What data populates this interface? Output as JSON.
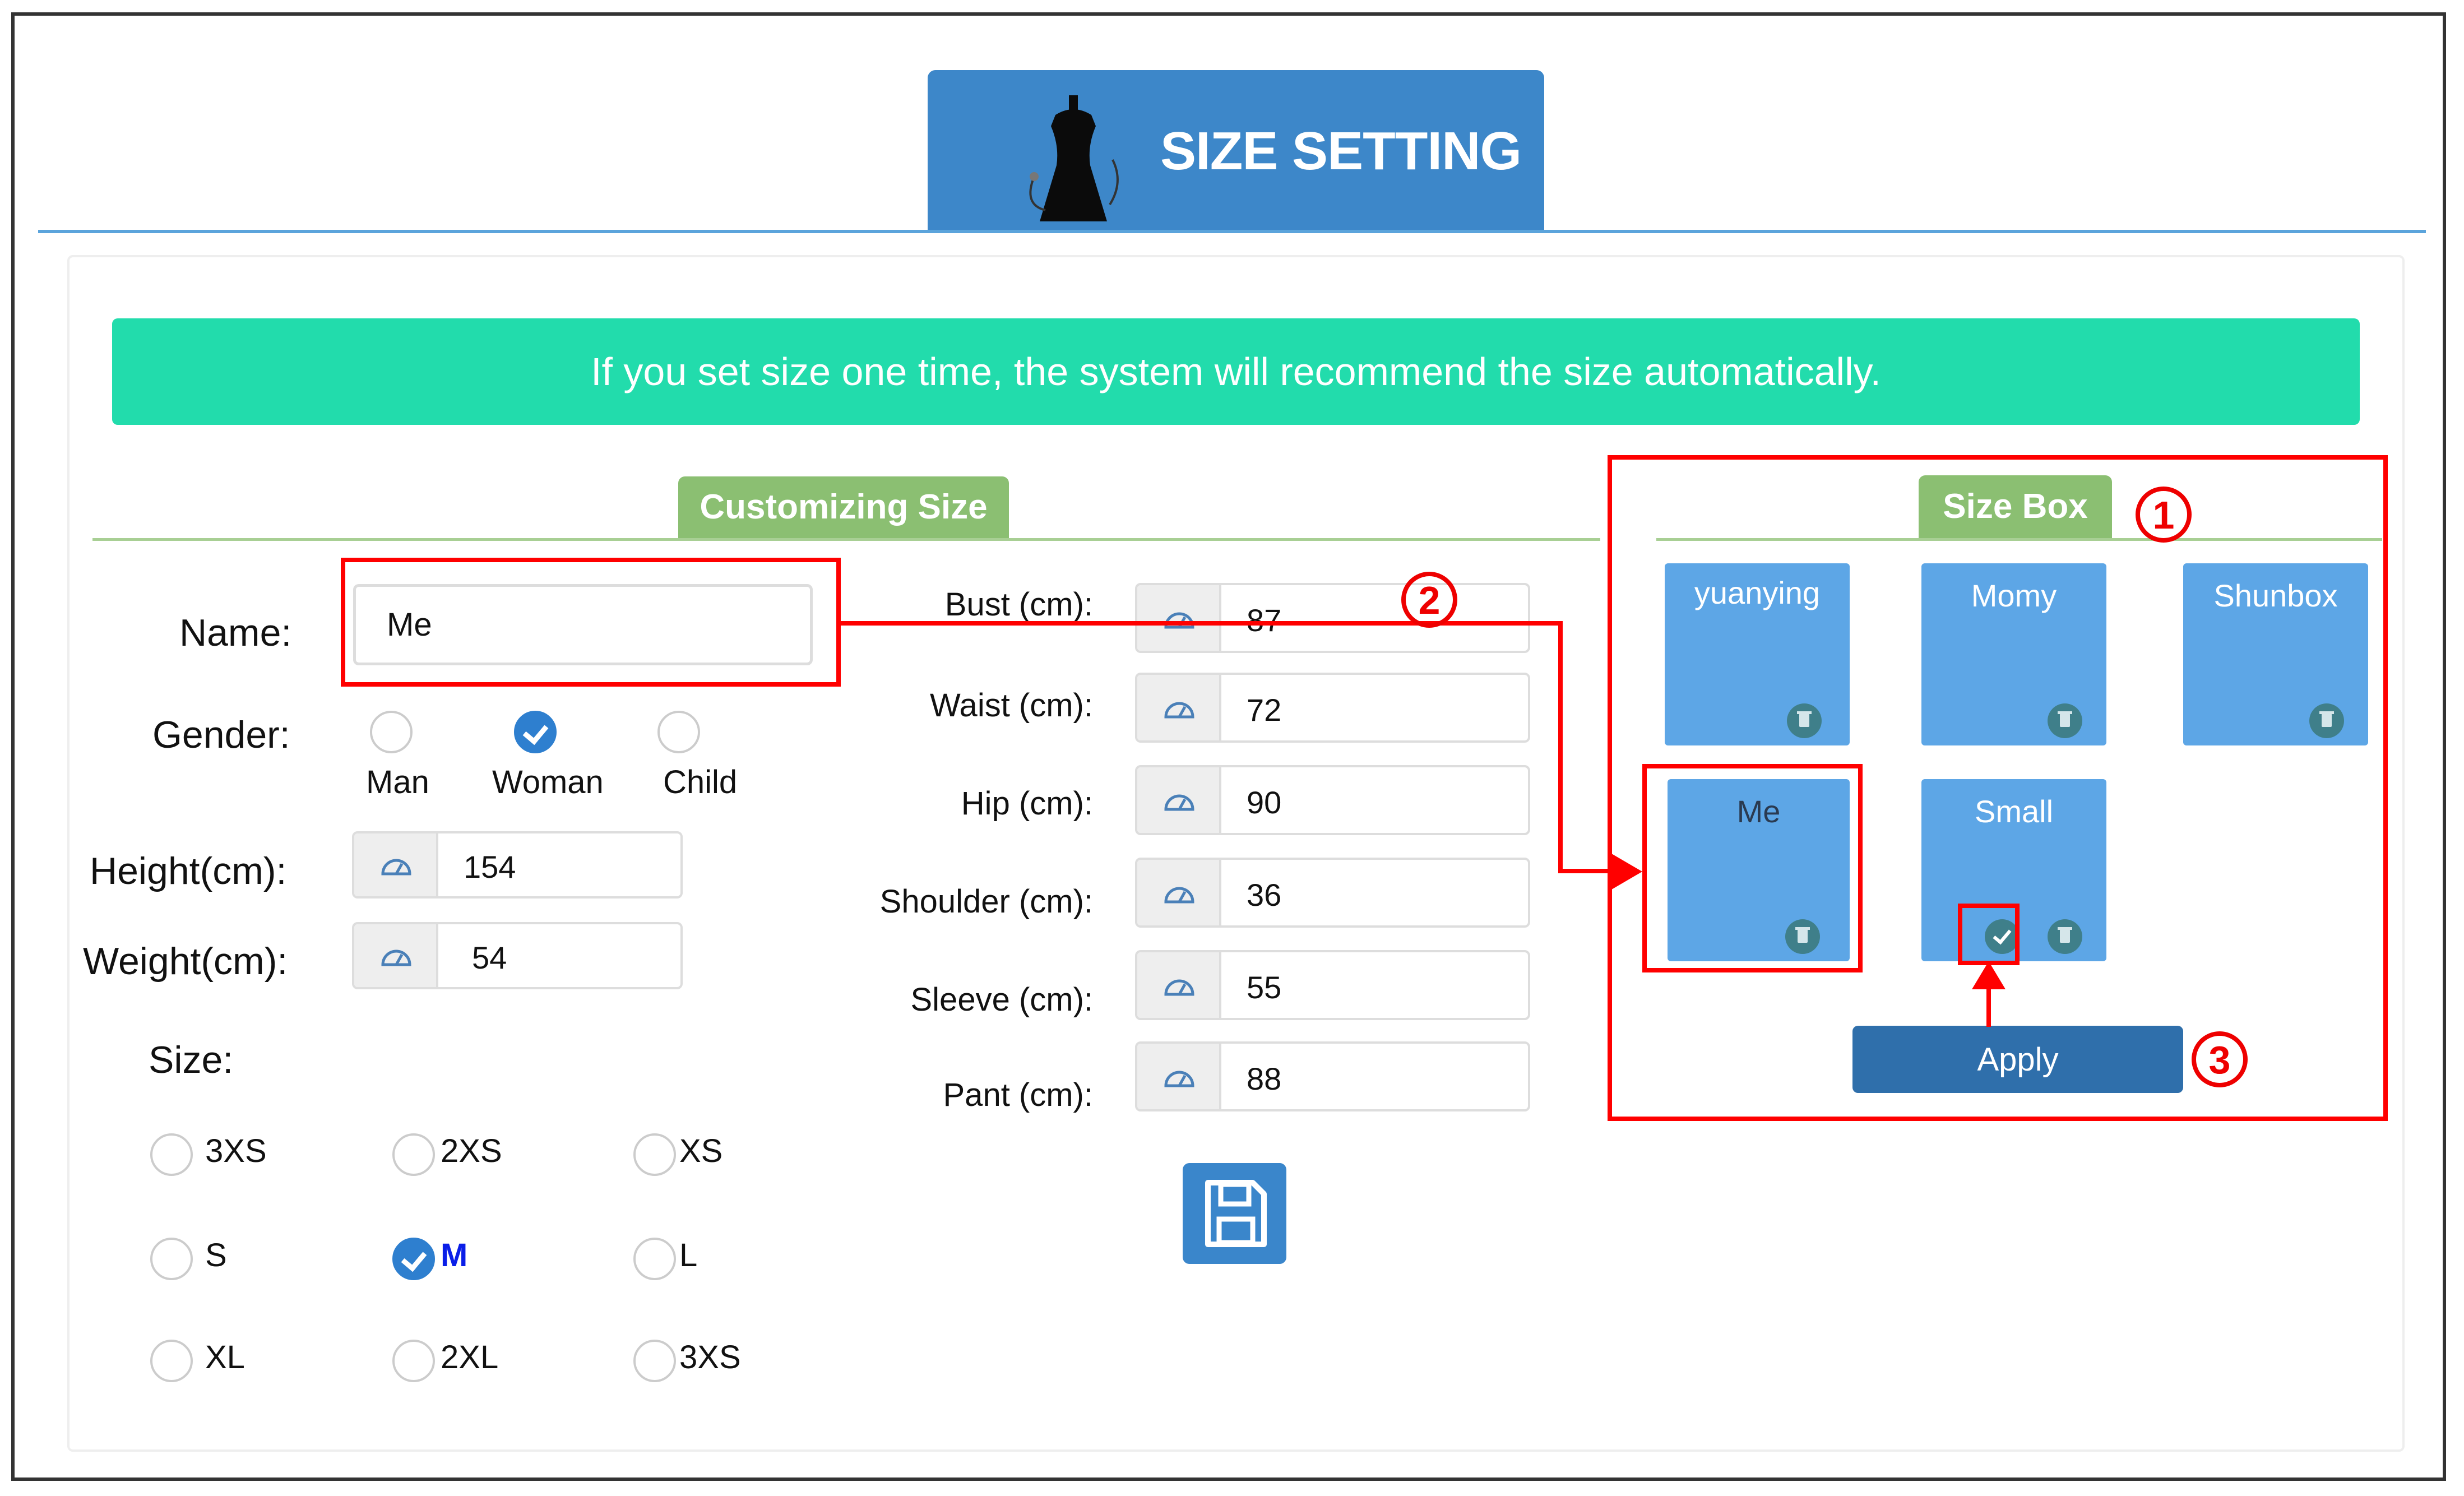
{
  "header": {
    "title": "SIZE SETTING",
    "icon": "dress-form-icon"
  },
  "banner": {
    "text": "If you set size one time, the system will recommend the size automatically."
  },
  "customizing": {
    "tab_label": "Customizing Size",
    "name": {
      "label": "Name:",
      "value": "Me"
    },
    "gender": {
      "label": "Gender:",
      "options": [
        "Man",
        "Woman",
        "Child"
      ],
      "selected": "Woman"
    },
    "height": {
      "label": "Height(cm):",
      "value": "154"
    },
    "weight": {
      "label": "Weight(cm):",
      "value": "54"
    },
    "size": {
      "label": "Size:",
      "options": [
        "3XS",
        "2XS",
        "XS",
        "S",
        "M",
        "L",
        "XL",
        "2XL",
        "3XS"
      ],
      "selected": "M"
    },
    "measurements": [
      {
        "label": "Bust (cm):",
        "value": "87"
      },
      {
        "label": "Waist (cm):",
        "value": "72"
      },
      {
        "label": "Hip (cm):",
        "value": "90"
      },
      {
        "label": "Shoulder (cm):",
        "value": "36"
      },
      {
        "label": "Sleeve (cm):",
        "value": "55"
      },
      {
        "label": "Pant (cm):",
        "value": "88"
      }
    ],
    "save_icon": "floppy-disk-icon"
  },
  "size_box": {
    "tab_label": "Size Box",
    "profiles": [
      "yuanying",
      "Momy",
      "Shunbox",
      "Me",
      "Small"
    ],
    "apply_label": "Apply"
  },
  "annotations": {
    "one": "1",
    "two": "2",
    "three": "3"
  },
  "colors": {
    "header": "#3d87c9",
    "banner": "#22dcac",
    "tab": "#8bbf72",
    "box": "#5da6e6",
    "annotation": "#ff0000"
  }
}
